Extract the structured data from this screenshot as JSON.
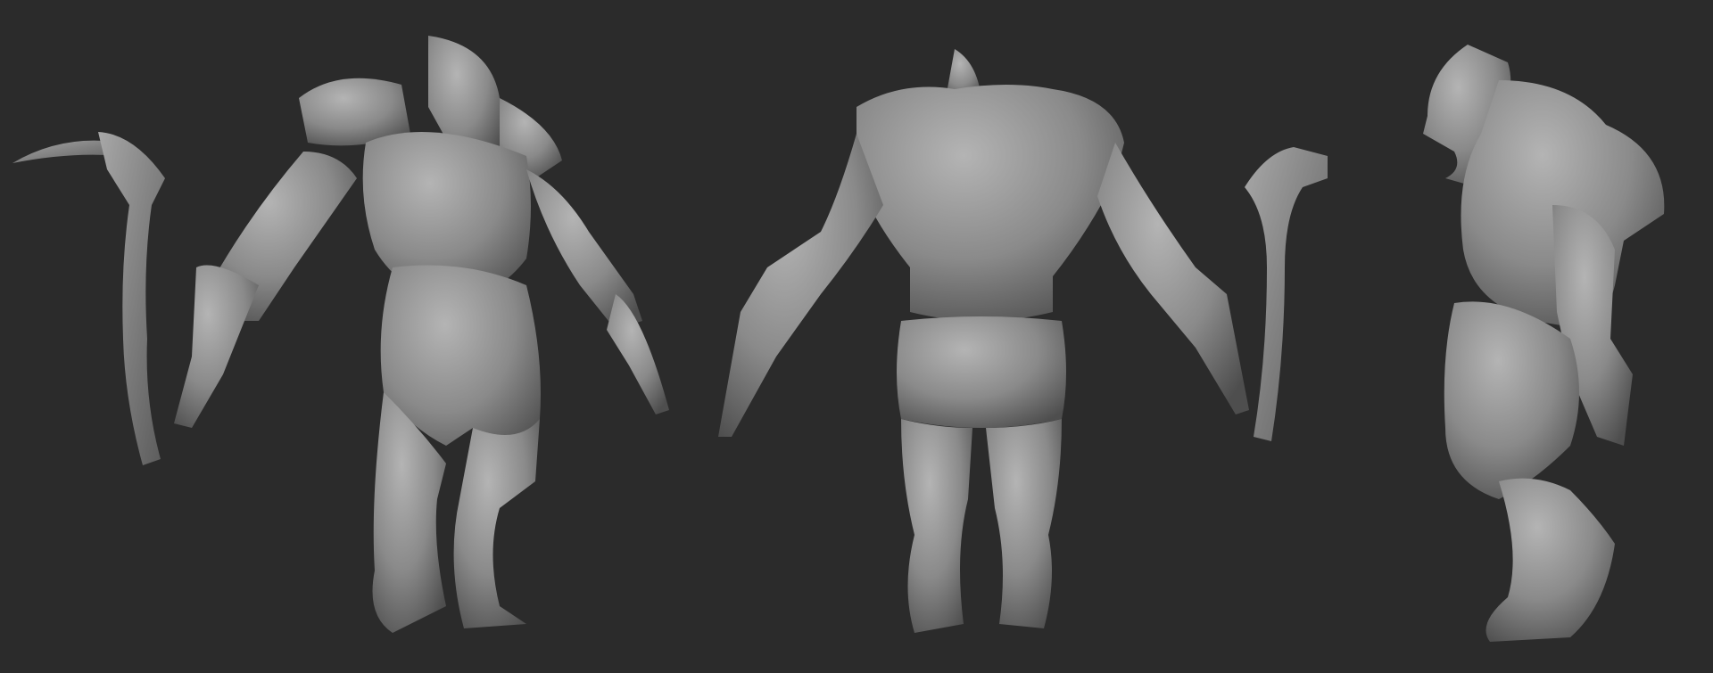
{
  "scene": {
    "background_color": "#2b2b2b",
    "clay_color": "#8a8a8a",
    "clay_highlight": "#b4b4b4",
    "clay_shadow": "#4e4e4e",
    "views": [
      "front",
      "back",
      "side"
    ]
  }
}
